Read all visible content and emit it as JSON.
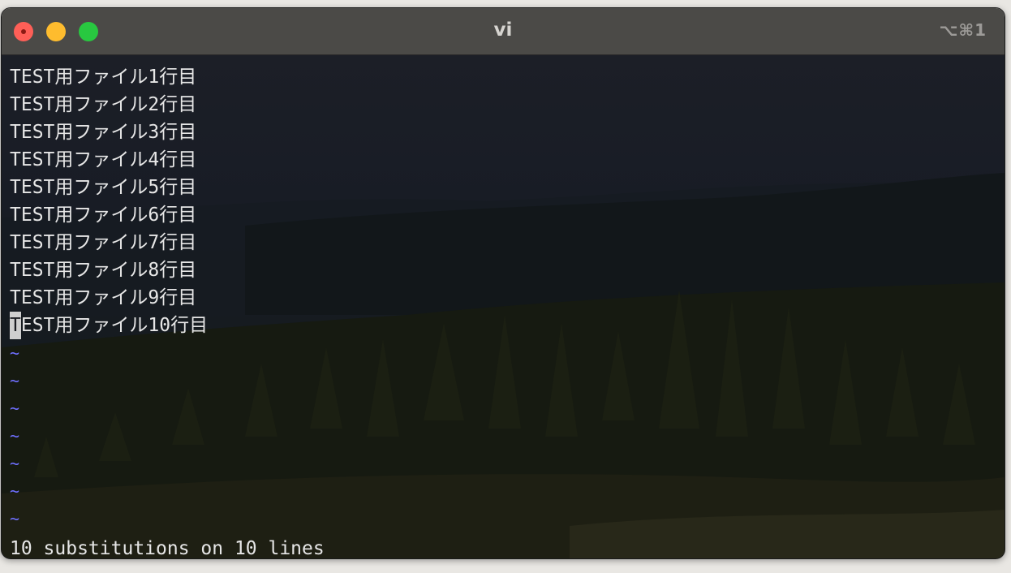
{
  "window": {
    "title": "vi",
    "shortcut": "⌥⌘1"
  },
  "buffer": {
    "lines": [
      "TEST用ファイル1行目",
      "TEST用ファイル2行目",
      "TEST用ファイル3行目",
      "TEST用ファイル4行目",
      "TEST用ファイル5行目",
      "TEST用ファイル6行目",
      "TEST用ファイル7行目",
      "TEST用ファイル8行目",
      "TEST用ファイル9行目"
    ],
    "cursor_line": {
      "cursor_char": "T",
      "rest": "EST用ファイル10行目"
    },
    "empty_line_marker": "~",
    "empty_line_count": 7
  },
  "status_line": "10 substitutions on 10 lines",
  "colors": {
    "tilde": "#6f6fff",
    "text": "#e6e6e6",
    "close": "#fe5f57",
    "minimize": "#febc2e",
    "maximize": "#28c840"
  }
}
